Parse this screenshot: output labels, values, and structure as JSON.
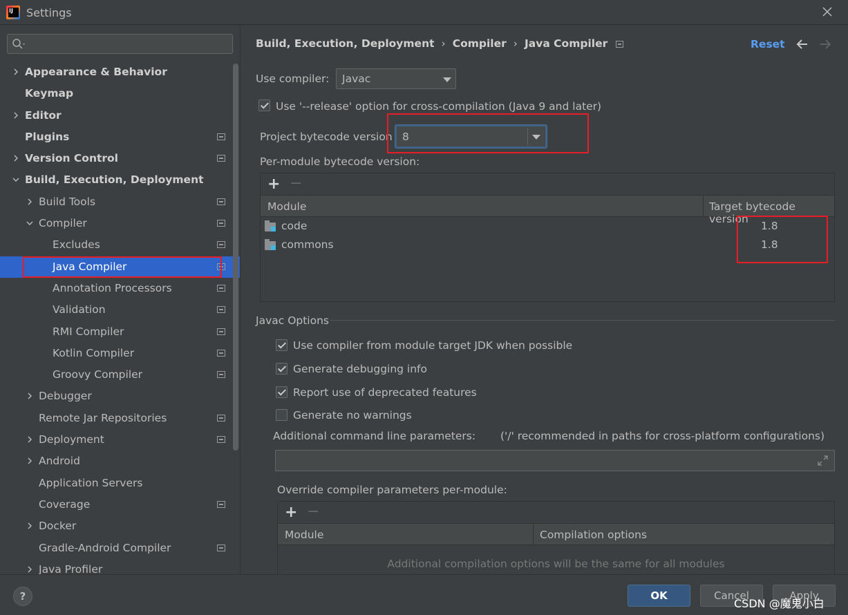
{
  "window": {
    "title": "Settings"
  },
  "search": {
    "placeholder": ""
  },
  "sidebar": {
    "items": [
      {
        "label": "Appearance & Behavior",
        "level": 0,
        "arrow": "right",
        "bold": true,
        "badge": false
      },
      {
        "label": "Keymap",
        "level": 0,
        "arrow": "none",
        "bold": true,
        "badge": false
      },
      {
        "label": "Editor",
        "level": 0,
        "arrow": "right",
        "bold": true,
        "badge": false
      },
      {
        "label": "Plugins",
        "level": 0,
        "arrow": "none",
        "bold": true,
        "badge": true
      },
      {
        "label": "Version Control",
        "level": 0,
        "arrow": "right",
        "bold": true,
        "badge": true
      },
      {
        "label": "Build, Execution, Deployment",
        "level": 0,
        "arrow": "down",
        "bold": true,
        "badge": false
      },
      {
        "label": "Build Tools",
        "level": 1,
        "arrow": "right",
        "bold": false,
        "badge": true
      },
      {
        "label": "Compiler",
        "level": 1,
        "arrow": "down",
        "bold": false,
        "badge": true
      },
      {
        "label": "Excludes",
        "level": 2,
        "arrow": "none",
        "bold": false,
        "badge": true
      },
      {
        "label": "Java Compiler",
        "level": 2,
        "arrow": "none",
        "bold": false,
        "badge": true,
        "selected": true
      },
      {
        "label": "Annotation Processors",
        "level": 2,
        "arrow": "none",
        "bold": false,
        "badge": true
      },
      {
        "label": "Validation",
        "level": 2,
        "arrow": "none",
        "bold": false,
        "badge": true
      },
      {
        "label": "RMI Compiler",
        "level": 2,
        "arrow": "none",
        "bold": false,
        "badge": true
      },
      {
        "label": "Kotlin Compiler",
        "level": 2,
        "arrow": "none",
        "bold": false,
        "badge": true
      },
      {
        "label": "Groovy Compiler",
        "level": 2,
        "arrow": "none",
        "bold": false,
        "badge": true
      },
      {
        "label": "Debugger",
        "level": 1,
        "arrow": "right",
        "bold": false,
        "badge": false
      },
      {
        "label": "Remote Jar Repositories",
        "level": 1,
        "arrow": "none",
        "bold": false,
        "badge": true
      },
      {
        "label": "Deployment",
        "level": 1,
        "arrow": "right",
        "bold": false,
        "badge": true
      },
      {
        "label": "Android",
        "level": 1,
        "arrow": "right",
        "bold": false,
        "badge": false
      },
      {
        "label": "Application Servers",
        "level": 1,
        "arrow": "none",
        "bold": false,
        "badge": false
      },
      {
        "label": "Coverage",
        "level": 1,
        "arrow": "none",
        "bold": false,
        "badge": true
      },
      {
        "label": "Docker",
        "level": 1,
        "arrow": "right",
        "bold": false,
        "badge": false
      },
      {
        "label": "Gradle-Android Compiler",
        "level": 1,
        "arrow": "none",
        "bold": false,
        "badge": true
      },
      {
        "label": "Java Profiler",
        "level": 1,
        "arrow": "right",
        "bold": false,
        "badge": false
      }
    ]
  },
  "breadcrumb": {
    "part1": "Build, Execution, Deployment",
    "sep": "›",
    "part2": "Compiler",
    "part3": "Java Compiler",
    "reset": "Reset"
  },
  "compiler": {
    "use_compiler_label": "Use compiler:",
    "use_compiler_value": "Javac",
    "release_option_label": "Use '--release' option for cross-compilation (Java 9 and later)",
    "release_option_checked": true,
    "project_bytecode_label": "Project bytecode version",
    "project_bytecode_value": "8",
    "per_module_label": "Per-module bytecode version:",
    "module_table": {
      "columns": [
        "Module",
        "Target bytecode version"
      ],
      "rows": [
        {
          "module": "code",
          "version": "1.8"
        },
        {
          "module": "commons",
          "version": "1.8"
        }
      ]
    }
  },
  "javac": {
    "section_title": "Javac Options",
    "options": [
      {
        "label": "Use compiler from module target JDK when possible",
        "checked": true
      },
      {
        "label": "Generate debugging info",
        "checked": true
      },
      {
        "label": "Report use of deprecated features",
        "checked": true
      },
      {
        "label": "Generate no warnings",
        "checked": false
      }
    ],
    "cmd_params_label": "Additional command line parameters:",
    "cmd_params_hint": "('/' recommended in paths for cross-platform configurations)",
    "cmd_params_value": "",
    "override_label": "Override compiler parameters per-module:",
    "override_table": {
      "columns": [
        "Module",
        "Compilation options"
      ],
      "empty_text": "Additional compilation options will be the same for all modules"
    }
  },
  "footer": {
    "help": "?",
    "ok": "OK",
    "cancel": "Cancel",
    "apply": "Apply",
    "watermark": "CSDN @魔鬼小白"
  },
  "colors": {
    "background": "#3c3f41",
    "selection": "#2f65ca",
    "link": "#589df6",
    "annotation_red": "#e81c24",
    "ok_button": "#365880"
  }
}
